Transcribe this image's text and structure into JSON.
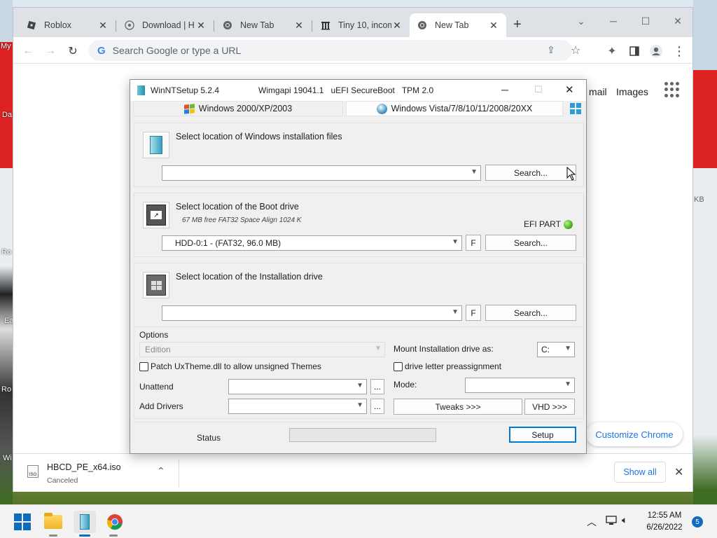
{
  "desktop": {
    "left_labels": [
      "My",
      "Da",
      "Ro",
      "Ea",
      "Ro",
      "Wi"
    ],
    "right_labels": [
      "KB"
    ]
  },
  "chrome": {
    "tabs": [
      {
        "label": "Roblox",
        "icon": "roblox-icon"
      },
      {
        "label": "Download | H",
        "icon": "disc-icon"
      },
      {
        "label": "New Tab",
        "icon": "chrome-icon"
      },
      {
        "label": "Tiny 10, incom",
        "icon": "archive-icon"
      },
      {
        "label": "New Tab",
        "icon": "chrome-icon",
        "active": true
      }
    ],
    "new_tab_symbol": "+",
    "omnibox_placeholder": "Search Google or type a URL",
    "header_links": [
      "Gmail",
      "Images"
    ],
    "header_gmail_partial": "mail",
    "customize_label": "Customize Chrome",
    "download": {
      "filename": "HBCD_PE_x64.iso",
      "status": "Canceled",
      "file_icon_text": "ISO"
    },
    "show_all_label": "Show all"
  },
  "winntsetup": {
    "title": "WinNTSetup 5.2.4",
    "info": [
      "Wimgapi 19041.1",
      "uEFI SecureBoot",
      "TPM 2.0"
    ],
    "tabs": [
      "Windows 2000/XP/2003",
      "Windows Vista/7/8/10/11/2008/20XX"
    ],
    "source": {
      "label": "Select location of Windows installation files",
      "value": "",
      "search": "Search..."
    },
    "boot": {
      "label": "Select location of the Boot drive",
      "sub": "67 MB free FAT32 Space Align 1024 K",
      "efi": "EFI PART",
      "value": "HDD-0:1 -   (FAT32, 96.0 MB)",
      "f": "F",
      "search": "Search..."
    },
    "install": {
      "label": "Select location of the Installation drive",
      "value": "",
      "f": "F",
      "search": "Search..."
    },
    "options": {
      "title": "Options",
      "edition_placeholder": "Edition",
      "patch_label": "Patch UxTheme.dll to allow unsigned Themes",
      "unattend_label": "Unattend",
      "drivers_label": "Add Drivers",
      "ellipsis": "...",
      "mount_label": "Mount Installation drive as:",
      "mount_value": "C:",
      "preassign_label": "drive letter preassignment",
      "mode_label": "Mode:",
      "tweaks_label": "Tweaks >>>",
      "vhd_label": "VHD >>>"
    },
    "status_label": "Status",
    "progress": 0,
    "setup_label": "Setup"
  },
  "taskbar": {
    "time": "12:55 AM",
    "date": "6/26/2022",
    "notification_count": "5",
    "pinned": [
      "windows-start-icon",
      "file-explorer-icon",
      "winntsetup-icon",
      "chrome-icon"
    ]
  },
  "colors": {
    "accent": "#1a73e8",
    "efi_led": "#4caf25",
    "taskbar_bg": "#f3f3f3",
    "chrome_tabstrip": "#dee1e6"
  }
}
